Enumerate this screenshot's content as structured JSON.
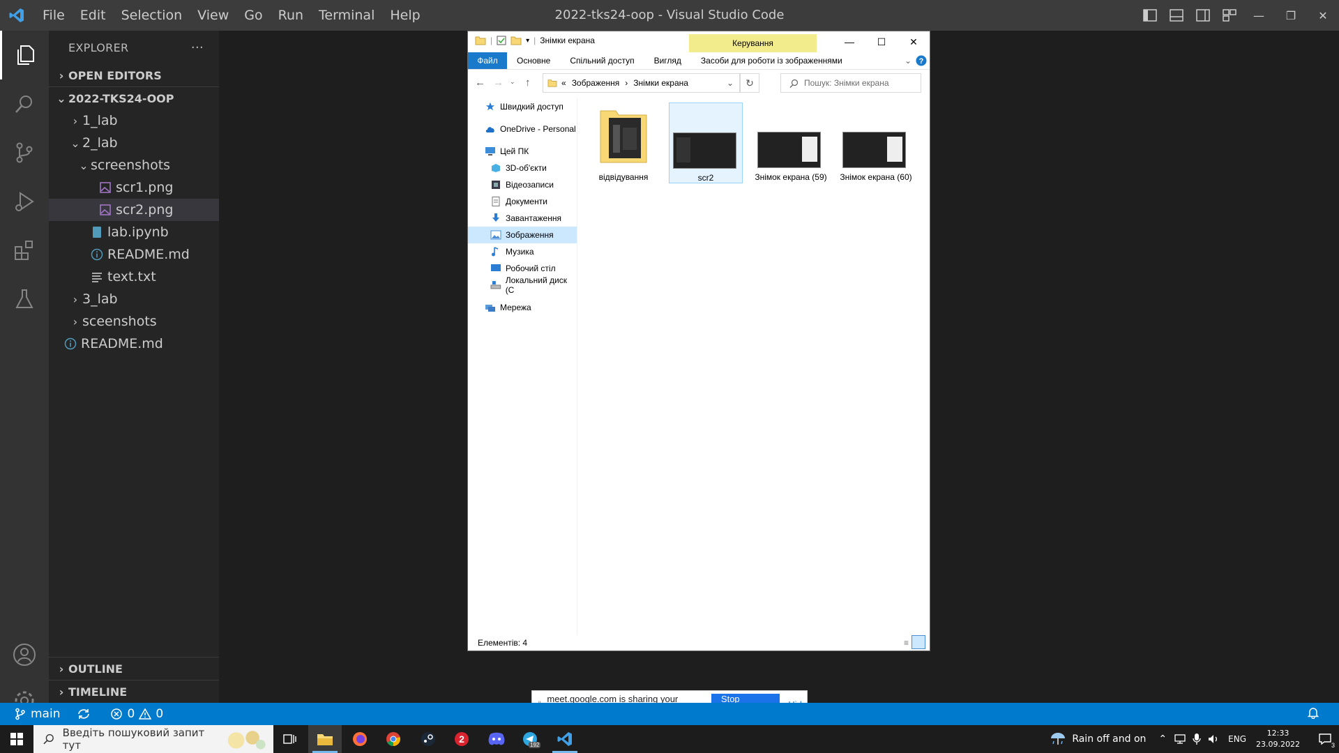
{
  "window": {
    "title": "2022-tks24-oop - Visual Studio Code",
    "menu": [
      "File",
      "Edit",
      "Selection",
      "View",
      "Go",
      "Run",
      "Terminal",
      "Help"
    ]
  },
  "sidebar": {
    "header": "EXPLORER",
    "more": "···",
    "open_editors": "OPEN EDITORS",
    "project": "2022-TKS24-OOP",
    "tree": [
      {
        "label": "1_lab",
        "type": "folder",
        "open": false,
        "depth": 1
      },
      {
        "label": "2_lab",
        "type": "folder",
        "open": true,
        "depth": 1
      },
      {
        "label": "screenshots",
        "type": "folder",
        "open": true,
        "depth": 2
      },
      {
        "label": "scr1.png",
        "type": "image",
        "depth": 3
      },
      {
        "label": "scr2.png",
        "type": "image",
        "depth": 3,
        "selected": true
      },
      {
        "label": "lab.ipynb",
        "type": "notebook",
        "depth": 2
      },
      {
        "label": "README.md",
        "type": "info",
        "depth": 2
      },
      {
        "label": "text.txt",
        "type": "text",
        "depth": 2
      },
      {
        "label": "3_lab",
        "type": "folder",
        "open": false,
        "depth": 1
      },
      {
        "label": "sceenshots",
        "type": "folder",
        "open": false,
        "depth": 1
      },
      {
        "label": "README.md",
        "type": "info",
        "depth": 1
      }
    ],
    "outline": "OUTLINE",
    "timeline": "TIMELINE"
  },
  "status": {
    "branch": "main",
    "errors": "0",
    "warnings": "0"
  },
  "explorer": {
    "title": "Знімки екрана",
    "manage": "Керування",
    "ribbon": [
      "Файл",
      "Основне",
      "Спільний доступ",
      "Вигляд",
      "Засоби для роботи із зображеннями"
    ],
    "breadcrumb_prefix": "«",
    "breadcrumb": [
      "Зображення",
      "Знімки екрана"
    ],
    "search_placeholder": "Пошук: Знімки екрана",
    "nav": [
      {
        "label": "Швидкий доступ",
        "icon": "star-icon"
      },
      {
        "label": "OneDrive - Personal",
        "icon": "cloud-icon"
      },
      {
        "label": "Цей ПК",
        "icon": "pc-icon"
      },
      {
        "label": "3D-об'єкти",
        "icon": "cube-icon"
      },
      {
        "label": "Відеозаписи",
        "icon": "video-icon"
      },
      {
        "label": "Документи",
        "icon": "document-icon"
      },
      {
        "label": "Завантаження",
        "icon": "download-icon"
      },
      {
        "label": "Зображення",
        "icon": "pictures-icon",
        "selected": true
      },
      {
        "label": "Музика",
        "icon": "music-icon"
      },
      {
        "label": "Робочий стіл",
        "icon": "desktop-icon"
      },
      {
        "label": "Локальний диск (C",
        "icon": "disk-icon"
      },
      {
        "label": "Мережа",
        "icon": "network-icon"
      }
    ],
    "items": [
      {
        "label": "відвідування",
        "kind": "folder"
      },
      {
        "label": "scr2",
        "kind": "image",
        "selected": true
      },
      {
        "label": "Знімок екрана (59)",
        "kind": "image"
      },
      {
        "label": "Знімок екрана (60)",
        "kind": "image"
      }
    ],
    "count": "Елементів: 4"
  },
  "share_bar": {
    "message": "meet.google.com is sharing your screen.",
    "stop": "Stop sharing",
    "hide": "Hide"
  },
  "taskbar": {
    "search_placeholder": "Введіть пошуковий запит тут",
    "weather": "Rain off and on",
    "lang": "ENG",
    "time": "12:33",
    "date": "23.09.2022",
    "notif_count": "3",
    "telegram_badge": "192"
  },
  "colors": {
    "accent": "#007acc",
    "titlebar": "#3c3c3c",
    "sidebar": "#252526",
    "activity": "#333333",
    "editor": "#1e1e1e",
    "explorer_file_tab": "#1979ca",
    "manage_tab": "#f3ec8d"
  }
}
